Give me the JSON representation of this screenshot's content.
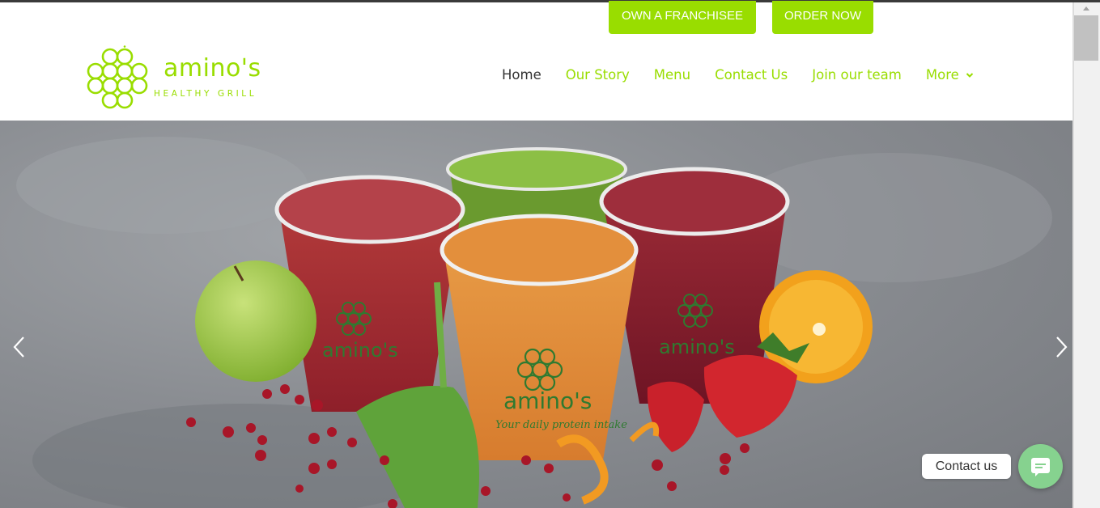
{
  "header": {
    "cta_franchise": "OWN A FRANCHISEE",
    "cta_order": "ORDER NOW",
    "logo": {
      "wordmark": "amino's",
      "tagline": "HEALTHY GRILL"
    },
    "nav": {
      "items": [
        {
          "label": "Home",
          "active": true
        },
        {
          "label": "Our Story",
          "active": false
        },
        {
          "label": "Menu",
          "active": false
        },
        {
          "label": "Contact Us",
          "active": false
        },
        {
          "label": "Join our team",
          "active": false
        }
      ],
      "more_label": "More"
    }
  },
  "hero": {
    "cup_brand": "amino's",
    "cup_slogan": "Your daily protein intake"
  },
  "contact_widget": {
    "label": "Contact us"
  },
  "colors": {
    "brand_green": "#99dd00",
    "nav_active": "#333333",
    "contact_button": "#86d28f"
  },
  "icons": [
    "honeycomb-logo-icon",
    "chevron-down-icon",
    "chevron-left-icon",
    "chevron-right-icon",
    "chat-icon"
  ]
}
